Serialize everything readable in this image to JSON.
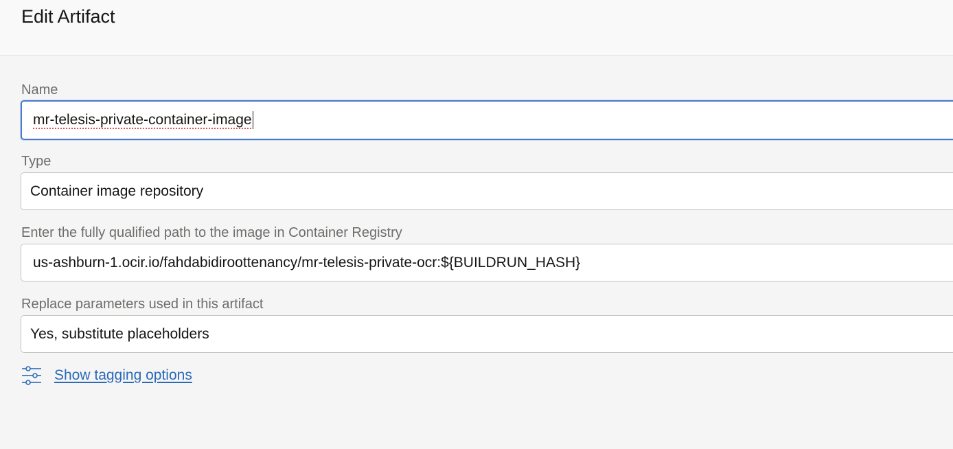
{
  "header": {
    "title": "Edit Artifact"
  },
  "fields": {
    "name": {
      "label": "Name",
      "value": "mr-telesis-private-container-image"
    },
    "type": {
      "label": "Type",
      "value": "Container image repository"
    },
    "image_path": {
      "label": "Enter the fully qualified path to the image in Container Registry",
      "value": "us-ashburn-1.ocir.io/fahdabidiroottenancy/mr-telesis-private-ocr:${BUILDRUN_HASH}"
    },
    "replace_params": {
      "label": "Replace parameters used in this artifact",
      "value": "Yes, substitute placeholders"
    }
  },
  "tagging": {
    "icon": "sliders-icon",
    "link_label": "Show tagging options"
  },
  "colors": {
    "accent": "#2a6ab8",
    "focus_border": "#4a7ac8",
    "label": "#6f6d6a"
  }
}
